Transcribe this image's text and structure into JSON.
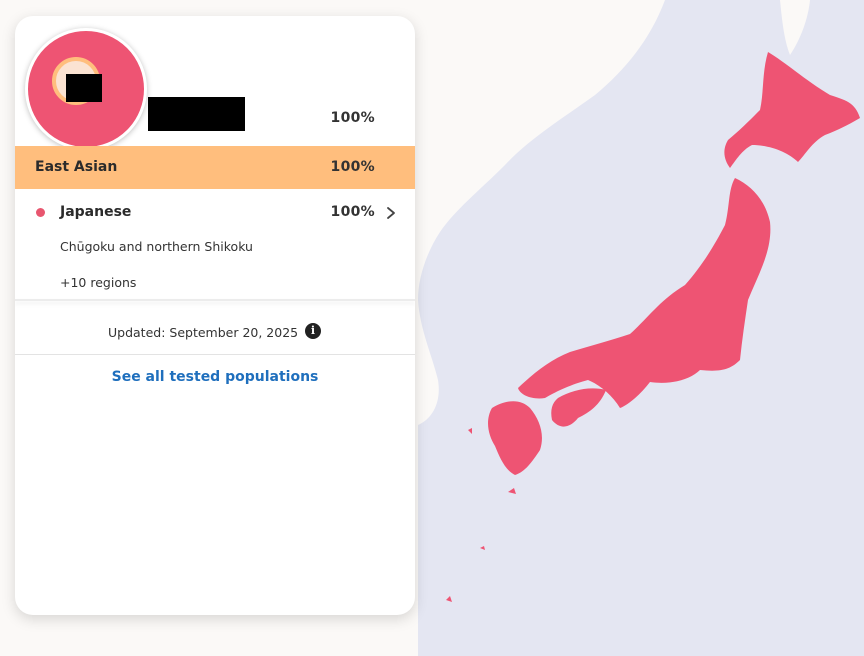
{
  "colors": {
    "sea": "#e4e6f2",
    "land": "#fbf9f7",
    "japan": "#ee5473",
    "east_asian_band": "#ffbe7d",
    "link": "#1f6fbd"
  },
  "summary": {
    "top_percent": "100%"
  },
  "group": {
    "label": "East Asian",
    "percent": "100%"
  },
  "population": {
    "label": "Japanese",
    "percent": "100%",
    "region": "Chūgoku and northern Shikoku",
    "more_regions": "+10 regions",
    "icon": "chevron-right-icon"
  },
  "footer": {
    "updated": "Updated: September 20, 2025",
    "info_icon": "info-icon",
    "info_glyph": "i",
    "see_all": "See all tested populations"
  }
}
